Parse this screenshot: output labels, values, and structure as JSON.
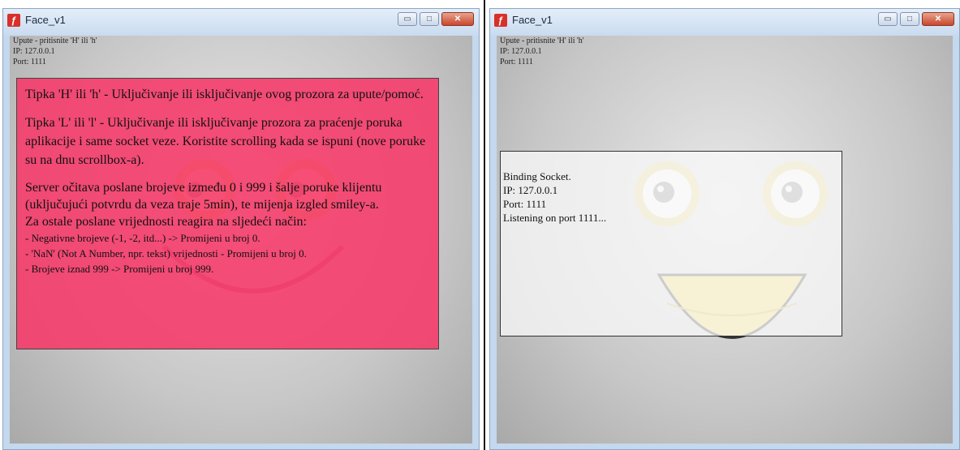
{
  "window": {
    "title": "Face_v1",
    "app_icon": "adobe-flash-icon",
    "controls": {
      "minimize": "▭",
      "maximize": "□",
      "close": "✕"
    }
  },
  "info": {
    "help_hint": "Upute - pritisnite 'H' ili 'h'",
    "ip": "IP: 127.0.0.1",
    "port": "Port: 1111"
  },
  "help": {
    "p1": "Tipka 'H' ili 'h' -  Uključivanje ili isključivanje ovog prozora za upute/pomoć.",
    "p2": "Tipka 'L' ili 'l' - Uključivanje ili isključivanje prozora za praćenje poruka aplikacije i same socket veze. Koristite scrolling kada se ispuni (nove poruke su na dnu scrollbox-a).",
    "p3a": "Server očitava poslane brojeve između 0 i 999 i šalje poruke klijentu (uključujući potvrdu da veza traje 5min), te mijenja izgled smiley-a.",
    "p3b": "Za ostale poslane vrijednosti reagira na sljedeći način:",
    "rules": [
      "- Negativne brojeve (-1, -2, itd...)  -> Promijeni u broj 0.",
      "- 'NaN' (Not A Number, npr. tekst) vrijednosti  - Promijeni u  broj 0.",
      "- Brojeve iznad 999 -> Promijeni u broj 999."
    ]
  },
  "log": {
    "lines": [
      "Binding Socket.",
      "IP: 127.0.0.1",
      "Port: 1111",
      "Listening on port 1111..."
    ]
  },
  "colors": {
    "help_panel": "#f63868",
    "log_panel": "#f7f7f7",
    "smiley_yellow": "#f2d23a"
  }
}
